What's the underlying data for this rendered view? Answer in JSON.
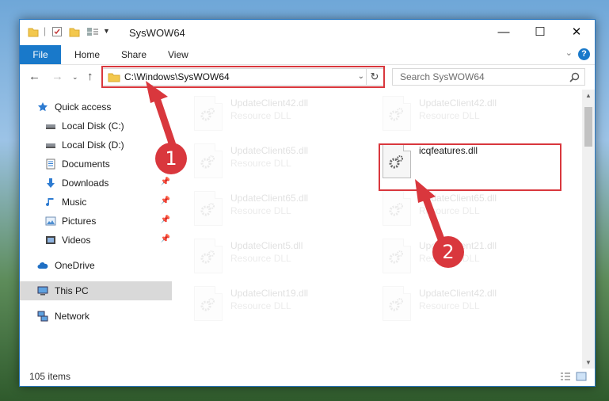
{
  "window": {
    "title": "SysWOW64"
  },
  "controls": {
    "minimize": "—",
    "maximize": "☐",
    "close": "✕"
  },
  "ribbon": {
    "file": "File",
    "home": "Home",
    "share": "Share",
    "view": "View",
    "help": "?"
  },
  "address": {
    "path": "C:\\Windows\\SysWOW64"
  },
  "search": {
    "placeholder": "Search SysWOW64"
  },
  "sidebar": {
    "items": [
      {
        "label": "Quick access",
        "icon": "star-icon"
      },
      {
        "label": "Local Disk (C:)",
        "icon": "drive-icon"
      },
      {
        "label": "Local Disk (D:)",
        "icon": "drive-icon"
      },
      {
        "label": "Documents",
        "icon": "document-icon"
      },
      {
        "label": "Downloads",
        "icon": "download-icon"
      },
      {
        "label": "Music",
        "icon": "music-icon"
      },
      {
        "label": "Pictures",
        "icon": "pictures-icon"
      },
      {
        "label": "Videos",
        "icon": "video-icon"
      },
      {
        "label": "OneDrive",
        "icon": "cloud-icon"
      },
      {
        "label": "This PC",
        "icon": "computer-icon"
      },
      {
        "label": "Network",
        "icon": "network-icon"
      }
    ]
  },
  "files": [
    {
      "name": "UpdateClient42.dll",
      "type": "Resource DLL"
    },
    {
      "name": "UpdateClient42.dll",
      "type": "Resource DLL"
    },
    {
      "name": "UpdateClient65.dll",
      "type": "Resource DLL"
    },
    {
      "name": "icqfeatures.dll",
      "type": ""
    },
    {
      "name": "UpdateClient65.dll",
      "type": "Resource DLL"
    },
    {
      "name": "UpdateClient65.dll",
      "type": "Resource DLL"
    },
    {
      "name": "UpdateClient5.dll",
      "type": "Resource DLL"
    },
    {
      "name": "UpdateClient21.dll",
      "type": "Resource DLL"
    },
    {
      "name": "UpdateClient19.dll",
      "type": "Resource DLL"
    },
    {
      "name": "UpdateClient42.dll",
      "type": "Resource DLL"
    }
  ],
  "status": {
    "count": "105 items"
  },
  "callouts": {
    "one": "1",
    "two": "2"
  },
  "colors": {
    "accent": "#1979ca",
    "highlight": "#d9373d",
    "selected": "#d9d9d9"
  }
}
